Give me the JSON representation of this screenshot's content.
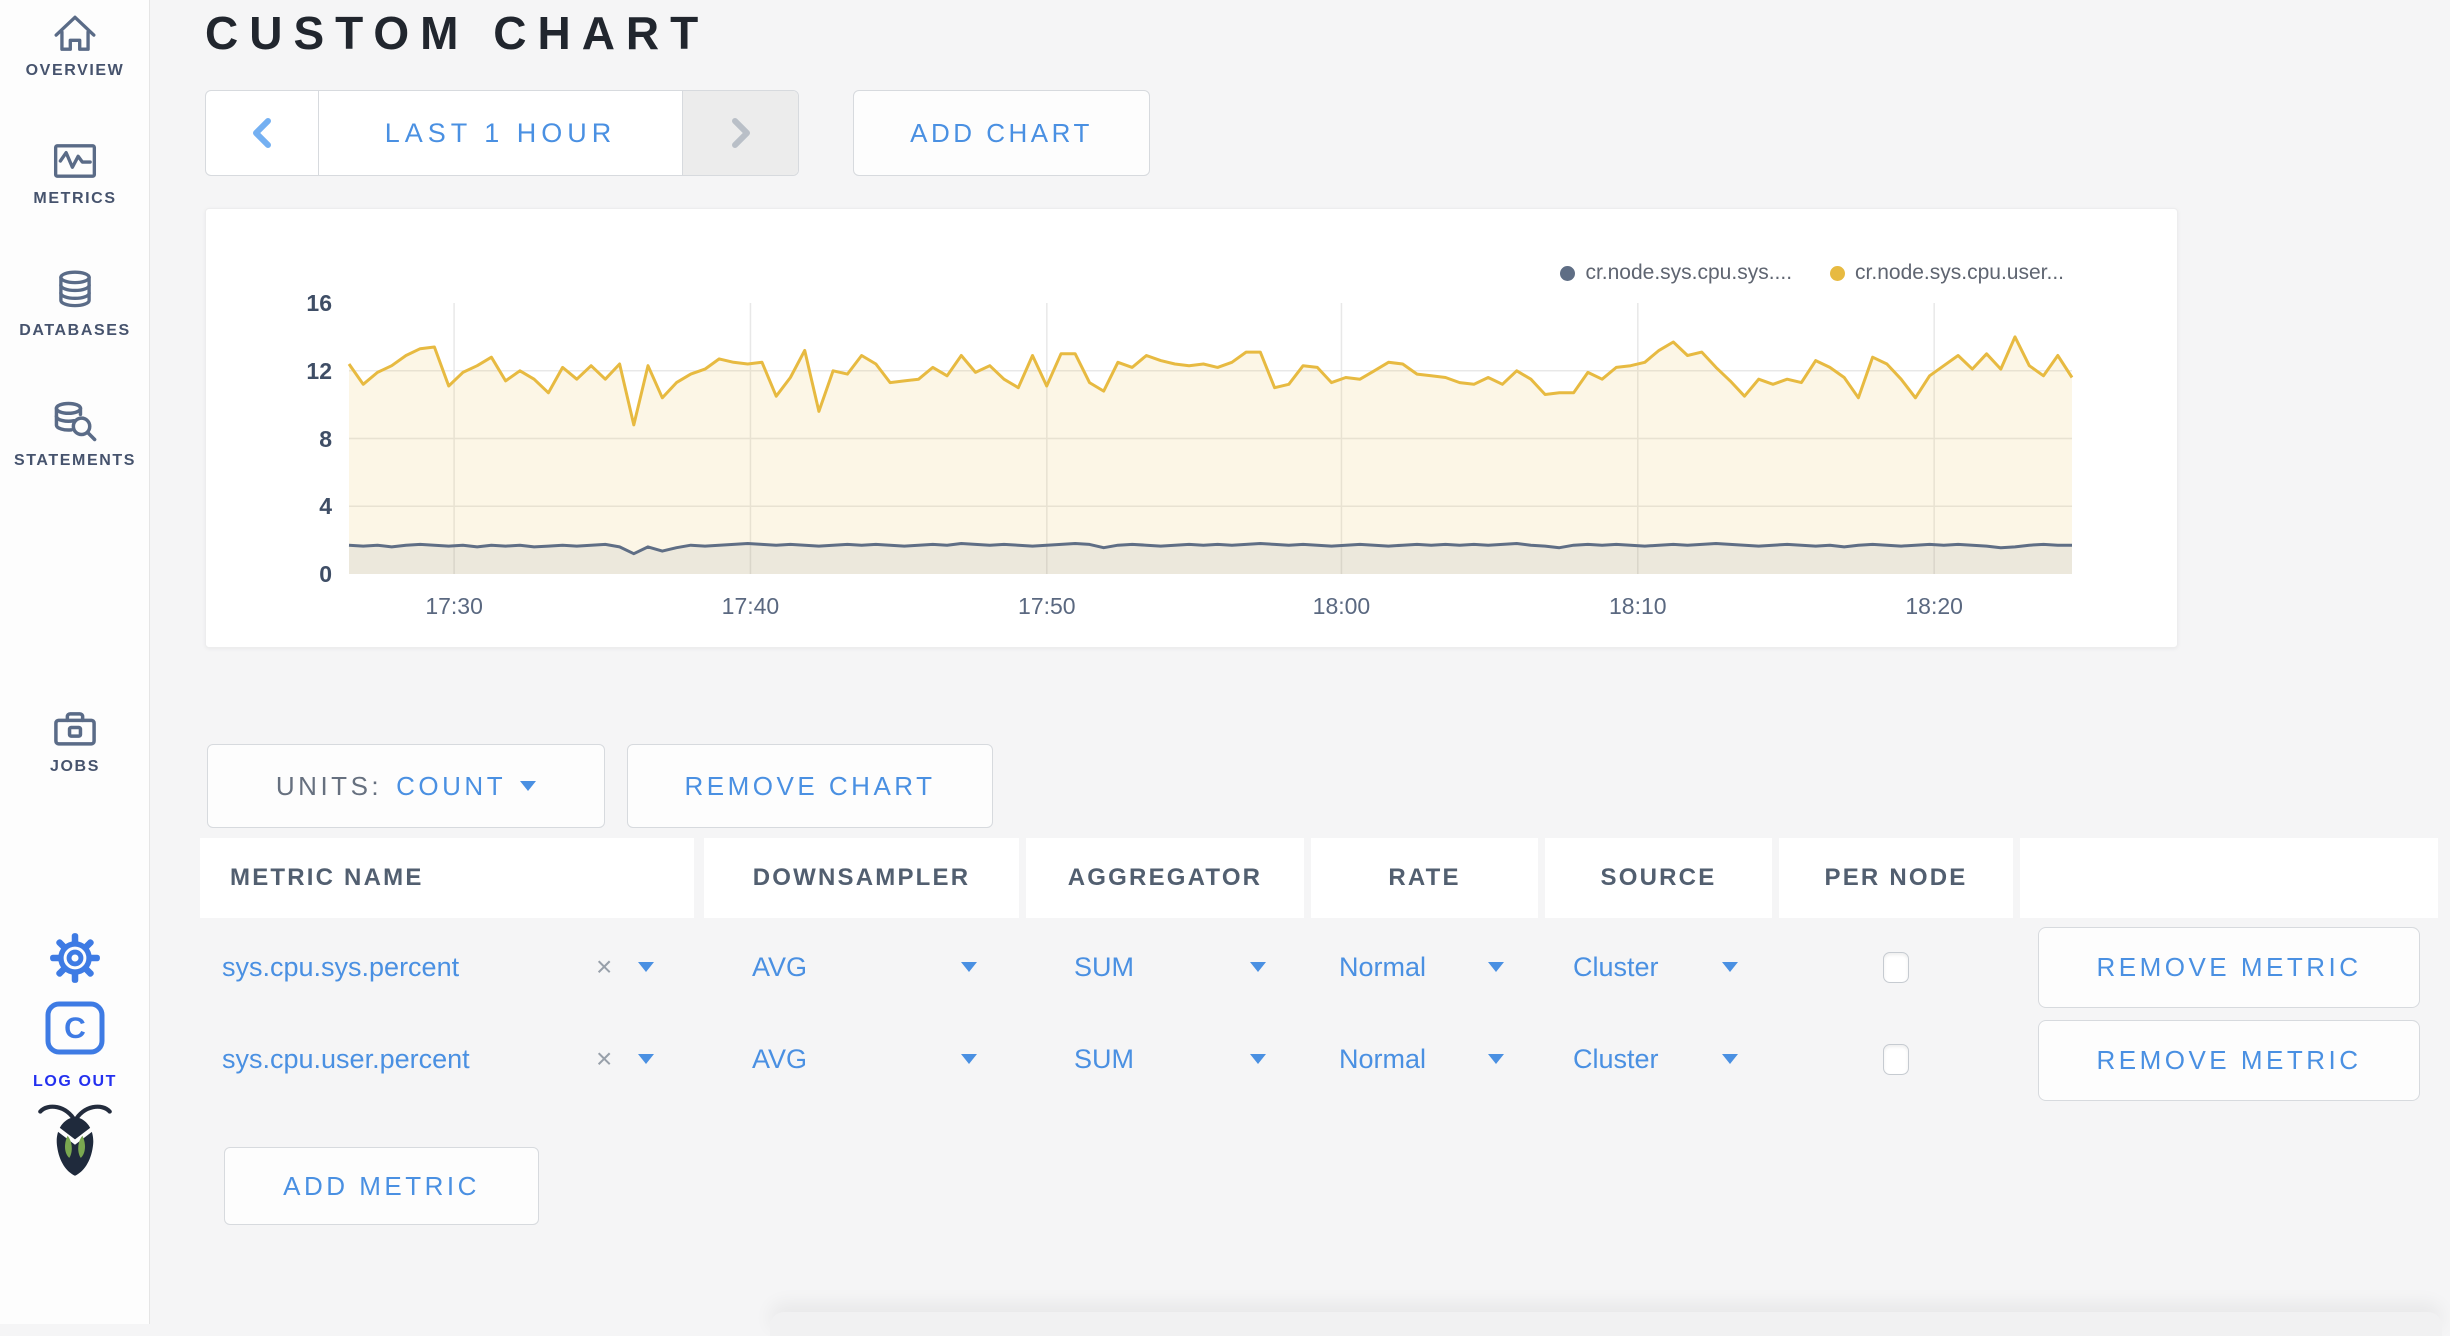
{
  "header": {
    "title": "CUSTOM CHART"
  },
  "sidebar": {
    "items": [
      {
        "label": "OVERVIEW",
        "icon": "home-icon"
      },
      {
        "label": "METRICS",
        "icon": "metrics-icon"
      },
      {
        "label": "DATABASES",
        "icon": "databases-icon"
      },
      {
        "label": "STATEMENTS",
        "icon": "statements-icon"
      },
      {
        "label": "JOBS",
        "icon": "jobs-icon"
      }
    ],
    "logout_label": "LOG OUT"
  },
  "time_selector": {
    "label": "LAST 1 HOUR"
  },
  "toolbar": {
    "add_chart_label": "ADD CHART"
  },
  "chart_controls": {
    "units_label": "UNITS:",
    "units_value": "COUNT",
    "remove_chart_label": "REMOVE CHART",
    "add_metric_label": "ADD METRIC"
  },
  "table": {
    "headers": [
      "METRIC NAME",
      "DOWNSAMPLER",
      "AGGREGATOR",
      "RATE",
      "SOURCE",
      "PER NODE"
    ],
    "rows": [
      {
        "metric": "sys.cpu.sys.percent",
        "downsampler": "AVG",
        "aggregator": "SUM",
        "rate": "Normal",
        "source": "Cluster",
        "per_node_checked": false,
        "action_label": "REMOVE METRIC"
      },
      {
        "metric": "sys.cpu.user.percent",
        "downsampler": "AVG",
        "aggregator": "SUM",
        "rate": "Normal",
        "source": "Cluster",
        "per_node_checked": false,
        "action_label": "REMOVE METRIC"
      }
    ]
  },
  "colors": {
    "accent_blue": "#4a90e2",
    "logout_blue": "#2330ef",
    "icon_blue": "#3e7be4",
    "series_yellow": "#e7ba41",
    "series_slate": "#5f6e85",
    "title_dark": "#21262e"
  },
  "chart_data": {
    "type": "area",
    "title": "",
    "xlabel": "",
    "ylabel": "",
    "ylim": [
      0,
      16
    ],
    "yticks": [
      0,
      4,
      8,
      12,
      16
    ],
    "grid": true,
    "legend_position": "top-right",
    "xticks": [
      {
        "label": "17:30",
        "frac": 0.061
      },
      {
        "label": "17:40",
        "frac": 0.233
      },
      {
        "label": "17:50",
        "frac": 0.405
      },
      {
        "label": "18:00",
        "frac": 0.576
      },
      {
        "label": "18:10",
        "frac": 0.748
      },
      {
        "label": "18:20",
        "frac": 0.92
      }
    ],
    "x_range": [
      "17:26",
      "18:25"
    ],
    "series": [
      {
        "name": "cr.node.sys.cpu.sys....",
        "color": "#5f6e85",
        "fill": "rgba(95,110,133,0.10)",
        "values": [
          1.7,
          1.65,
          1.7,
          1.6,
          1.7,
          1.75,
          1.7,
          1.65,
          1.7,
          1.6,
          1.7,
          1.65,
          1.7,
          1.6,
          1.65,
          1.7,
          1.65,
          1.7,
          1.75,
          1.6,
          1.2,
          1.6,
          1.35,
          1.55,
          1.7,
          1.65,
          1.7,
          1.75,
          1.8,
          1.75,
          1.7,
          1.75,
          1.7,
          1.65,
          1.7,
          1.75,
          1.7,
          1.75,
          1.7,
          1.65,
          1.7,
          1.75,
          1.7,
          1.8,
          1.75,
          1.7,
          1.75,
          1.7,
          1.65,
          1.7,
          1.75,
          1.8,
          1.75,
          1.55,
          1.7,
          1.75,
          1.7,
          1.65,
          1.7,
          1.75,
          1.7,
          1.75,
          1.7,
          1.75,
          1.8,
          1.75,
          1.7,
          1.75,
          1.7,
          1.65,
          1.7,
          1.75,
          1.7,
          1.65,
          1.7,
          1.75,
          1.7,
          1.75,
          1.7,
          1.75,
          1.7,
          1.75,
          1.8,
          1.7,
          1.65,
          1.55,
          1.7,
          1.75,
          1.7,
          1.75,
          1.7,
          1.65,
          1.7,
          1.75,
          1.7,
          1.75,
          1.8,
          1.75,
          1.7,
          1.65,
          1.7,
          1.75,
          1.7,
          1.65,
          1.7,
          1.6,
          1.7,
          1.75,
          1.7,
          1.65,
          1.7,
          1.75,
          1.7,
          1.75,
          1.7,
          1.65,
          1.55,
          1.6,
          1.7,
          1.75,
          1.7,
          1.7
        ]
      },
      {
        "name": "cr.node.sys.cpu.user...",
        "color": "#e7ba41",
        "fill": "rgba(231,186,65,0.13)",
        "values": [
          12.4,
          11.2,
          11.9,
          12.3,
          12.9,
          13.3,
          13.4,
          11.1,
          11.9,
          12.3,
          12.8,
          11.4,
          12.0,
          11.5,
          10.7,
          12.2,
          11.5,
          12.3,
          11.5,
          12.4,
          8.8,
          12.3,
          10.4,
          11.3,
          11.8,
          12.1,
          12.7,
          12.5,
          12.4,
          12.5,
          10.5,
          11.6,
          13.2,
          9.6,
          12.0,
          11.8,
          12.9,
          12.4,
          11.3,
          11.4,
          11.5,
          12.2,
          11.7,
          12.9,
          11.9,
          12.3,
          11.5,
          11.0,
          12.9,
          11.1,
          13.0,
          13.0,
          11.3,
          10.8,
          12.5,
          12.2,
          12.9,
          12.6,
          12.4,
          12.3,
          12.4,
          12.2,
          12.5,
          13.1,
          13.1,
          11.0,
          11.2,
          12.3,
          12.2,
          11.3,
          11.6,
          11.5,
          12.0,
          12.5,
          12.4,
          11.8,
          11.7,
          11.6,
          11.3,
          11.2,
          11.6,
          11.2,
          12.0,
          11.5,
          10.6,
          10.7,
          10.7,
          11.9,
          11.5,
          12.2,
          12.3,
          12.5,
          13.2,
          13.7,
          12.9,
          13.1,
          12.2,
          11.4,
          10.5,
          11.5,
          11.2,
          11.5,
          11.3,
          12.6,
          12.2,
          11.6,
          10.4,
          12.8,
          12.4,
          11.5,
          10.4,
          11.7,
          12.3,
          12.9,
          12.1,
          13.0,
          12.1,
          14.0,
          12.3,
          11.7,
          12.9,
          11.6
        ]
      }
    ]
  }
}
